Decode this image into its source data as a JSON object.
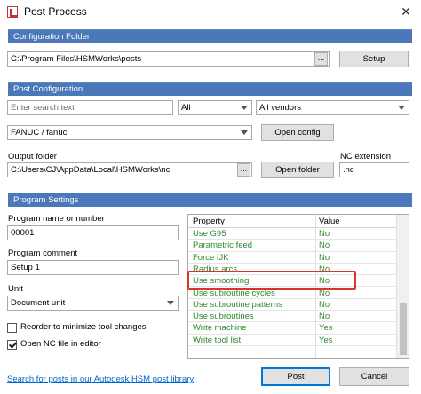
{
  "window": {
    "title": "Post Process",
    "close_glyph": "✕"
  },
  "config_folder": {
    "header": "Configuration Folder",
    "path": "C:\\Program Files\\HSMWorks\\posts",
    "browse_label": "...",
    "setup_label": "Setup"
  },
  "post_config": {
    "header": "Post Configuration",
    "search_placeholder": "Enter search text",
    "filter_selected": "All",
    "vendor_selected": "All vendors",
    "post_selected": "FANUC / fanuc",
    "open_config_label": "Open config",
    "output_folder_label": "Output folder",
    "output_folder_path": "C:\\Users\\CJ\\AppData\\Local\\HSMWorks\\nc",
    "browse_label": "...",
    "open_folder_label": "Open folder",
    "nc_extension_label": "NC extension",
    "nc_extension_value": ".nc"
  },
  "program_settings": {
    "header": "Program Settings",
    "program_name_label": "Program name or number",
    "program_name_value": "00001",
    "program_comment_label": "Program comment",
    "program_comment_value": "Setup 1",
    "unit_label": "Unit",
    "unit_selected": "Document unit",
    "reorder_label": "Reorder to minimize tool changes",
    "reorder_checked": false,
    "open_nc_label": "Open NC file in editor",
    "open_nc_checked": true
  },
  "property_grid": {
    "col_property": "Property",
    "col_value": "Value",
    "rows": [
      {
        "property": "Use G95",
        "value": "No"
      },
      {
        "property": "Parametric feed",
        "value": "No"
      },
      {
        "property": "Force IJK",
        "value": "No"
      },
      {
        "property": "Radius arcs",
        "value": "No"
      },
      {
        "property": "Use smoothing",
        "value": "No"
      },
      {
        "property": "Use subroutine cycles",
        "value": "No"
      },
      {
        "property": "Use subroutine patterns",
        "value": "No"
      },
      {
        "property": "Use subroutines",
        "value": "No"
      },
      {
        "property": "Write machine",
        "value": "Yes"
      },
      {
        "property": "Write tool list",
        "value": "Yes"
      }
    ],
    "highlighted_row": "Use smoothing",
    "highlight_color": "#d9342b",
    "row_text_color": "#2e8b2e"
  },
  "footer": {
    "library_link": "Search for posts in our Autodesk HSM post library",
    "post_label": "Post",
    "cancel_label": "Cancel"
  },
  "colors": {
    "section_header": "#4a78b8",
    "link": "#0066cc"
  }
}
